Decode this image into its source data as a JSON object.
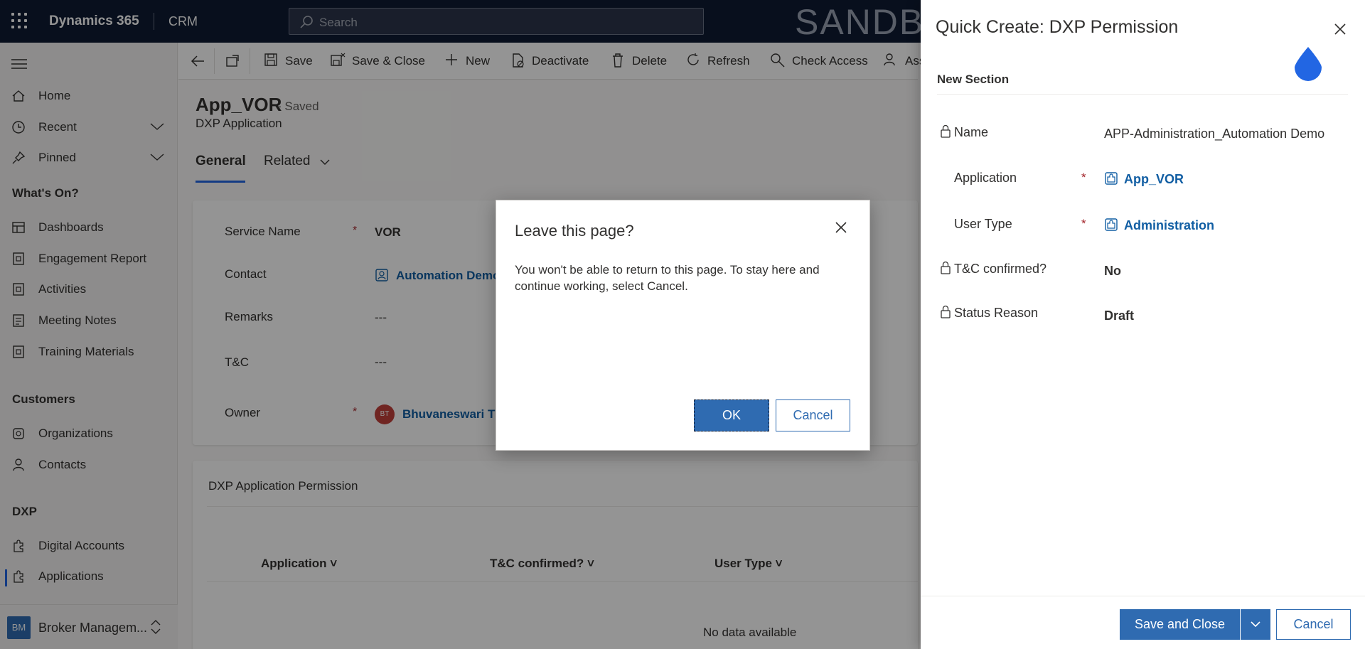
{
  "topbar": {
    "app_title": "Dynamics 365",
    "module": "CRM",
    "search_placeholder": "Search",
    "environment": "SANDBOX"
  },
  "sidebar": {
    "items": [
      {
        "label": "Home",
        "icon": "home-icon"
      },
      {
        "label": "Recent",
        "icon": "clock-icon"
      },
      {
        "label": "Pinned",
        "icon": "pin-icon"
      }
    ],
    "groups": [
      {
        "title": "What's On?",
        "items": [
          {
            "label": "Dashboards",
            "icon": "dashboard-icon"
          },
          {
            "label": "Engagement Report",
            "icon": "report-icon"
          },
          {
            "label": "Activities",
            "icon": "activity-icon"
          },
          {
            "label": "Meeting Notes",
            "icon": "notes-icon"
          },
          {
            "label": "Training Materials",
            "icon": "training-icon"
          }
        ]
      },
      {
        "title": "Customers",
        "items": [
          {
            "label": "Organizations",
            "icon": "organization-icon"
          },
          {
            "label": "Contacts",
            "icon": "contact-icon"
          }
        ]
      },
      {
        "title": "DXP",
        "items": [
          {
            "label": "Digital Accounts",
            "icon": "puzzle-icon"
          },
          {
            "label": "Applications",
            "icon": "puzzle-icon"
          }
        ]
      }
    ],
    "area": {
      "badge": "BM",
      "label": "Broker Managem..."
    }
  },
  "commandbar": {
    "save": "Save",
    "save_close": "Save & Close",
    "new": "New",
    "deactivate": "Deactivate",
    "delete": "Delete",
    "refresh": "Refresh",
    "check_access": "Check Access",
    "assign": "Ass"
  },
  "record": {
    "title": "App_VOR",
    "saved": "- Saved",
    "entity": "DXP Application",
    "tabs": [
      "General",
      "Related"
    ]
  },
  "form": {
    "service_name_label": "Service Name",
    "service_name": "VOR",
    "contact_label": "Contact",
    "contact": "Automation Demo",
    "remarks_label": "Remarks",
    "remarks": "---",
    "tc_label": "T&C",
    "tc": "---",
    "owner_label": "Owner",
    "owner_initials": "BT",
    "owner": "Bhuvaneswari Th",
    "required_marker": "*"
  },
  "subgrid": {
    "title": "DXP Application Permission",
    "columns": [
      "Application",
      "T&C confirmed?",
      "User Type"
    ],
    "empty": "No data available"
  },
  "dialog": {
    "title": "Leave this page?",
    "message": "You won't be able to return to this page. To stay here and continue working, select Cancel.",
    "ok": "OK",
    "cancel": "Cancel"
  },
  "quick_create": {
    "title": "Quick Create: DXP Permission",
    "section": "New Section",
    "name_label": "Name",
    "name": "APP-Administration_Automation Demo",
    "application_label": "Application",
    "application": "App_VOR",
    "user_type_label": "User Type",
    "user_type": "Administration",
    "tc_label": "T&C confirmed?",
    "tc": "No",
    "status_label": "Status Reason",
    "status": "Draft",
    "save_close": "Save and Close",
    "cancel": "Cancel"
  },
  "colors": {
    "topbar": "#0f1b33",
    "accent": "#2f6bb1",
    "link": "#115ea3",
    "required": "#a4262c",
    "drop": "#2266e3"
  }
}
